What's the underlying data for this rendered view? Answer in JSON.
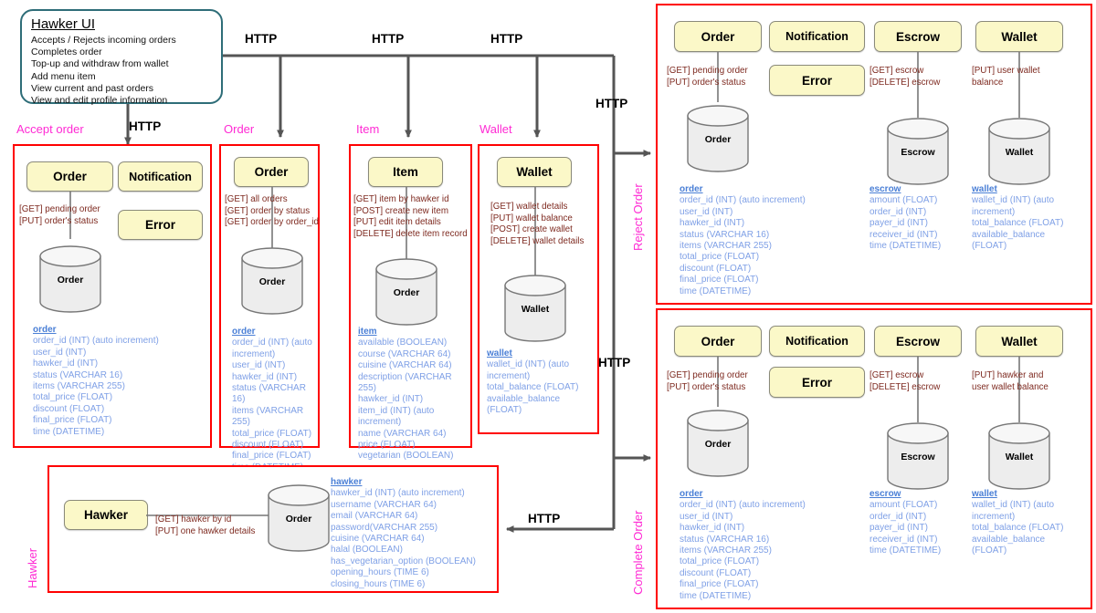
{
  "ui_box": {
    "title": "Hawker UI",
    "lines": [
      "Accepts / Rejects incoming orders",
      "Completes order",
      "Top-up and withdraw from wallet",
      "Add menu item",
      "View current and past orders",
      "View and edit profile information"
    ]
  },
  "connector_labels": {
    "http": "HTTP",
    "http_top_1": "HTTP",
    "http_top_2": "HTTP",
    "http_top_3": "HTTP",
    "http_accept": "HTTP",
    "http_right_top": "HTTP",
    "http_right_bottom": "HTTP",
    "http_bottom": "HTTP"
  },
  "group_labels": {
    "accept_order": "Accept order",
    "order": "Order",
    "item": "Item",
    "wallet": "Wallet",
    "hawker": "Hawker",
    "reject_order": "Reject Order",
    "complete_order": "Complete Order"
  },
  "colors": {
    "group_border": "#ff0000",
    "magenta_label": "#ff2ad4",
    "service_fill": "#fbf8c8",
    "service_border": "#8a8a7a",
    "endpoint_text": "#7e2a20",
    "schema_text": "#7fa0e6",
    "schema_title": "#4a7fd6",
    "ui_border": "#2e6d78",
    "connector": "#555555"
  },
  "schemas": {
    "order": {
      "name": "order",
      "fields": [
        "order_id (INT) (auto increment)",
        "user_id (INT)",
        "hawker_id (INT)",
        "status (VARCHAR 16)",
        "items (VARCHAR 255)",
        "total_price (FLOAT)",
        "discount (FLOAT)",
        "final_price (FLOAT)",
        "time (DATETIME)"
      ]
    },
    "item": {
      "name": "item",
      "fields": [
        "available (BOOLEAN)",
        "course (VARCHAR 64)",
        "cuisine (VARCHAR 64)",
        "description (VARCHAR 255)",
        "hawker_id (INT)",
        "item_id (INT) (auto increment)",
        "name (VARCHAR 64)",
        "price (FLOAT)",
        "vegetarian (BOOLEAN)"
      ]
    },
    "wallet": {
      "name": "wallet",
      "fields": [
        "wallet_id (INT) (auto increment)",
        "total_balance (FLOAT)",
        "available_balance (FLOAT)"
      ]
    },
    "escrow": {
      "name": "escrow",
      "fields": [
        "amount (FLOAT)",
        "order_id (INT)",
        "payer_id (INT)",
        "receiver_id (INT)",
        "time (DATETIME)"
      ]
    },
    "hawker": {
      "name": "hawker",
      "fields": [
        "hawker_id (INT) (auto increment)",
        "username (VARCHAR 64)",
        "email (VARCHAR 64)",
        "password(VARCHAR 255)",
        "cuisine (VARCHAR 64)",
        "halal (BOOLEAN)",
        "has_vegetarian_option (BOOLEAN)",
        "opening_hours (TIME 6)",
        "closing_hours (TIME 6)"
      ]
    }
  },
  "panels": {
    "accept_order": {
      "label": "Accept order",
      "services": [
        "Order",
        "Notification",
        "Error"
      ],
      "endpoints": [
        "[GET] pending order",
        "[PUT] order's status"
      ],
      "db_label": "Order",
      "schema_key": "order"
    },
    "order": {
      "label": "Order",
      "service": "Order",
      "endpoints": [
        "[GET] all orders",
        "[GET] order by status",
        "[GET] order by order_id"
      ],
      "db_label": "Order",
      "schema_key": "order"
    },
    "item": {
      "label": "Item",
      "service": "Item",
      "endpoints": [
        "[GET] item by hawker id",
        "[POST] create new item",
        "[PUT] edit item details",
        "[DELETE] delete item record"
      ],
      "db_label": "Order",
      "schema_key": "item"
    },
    "wallet": {
      "label": "Wallet",
      "service": "Wallet",
      "endpoints": [
        "[GET] wallet details",
        "[PUT] wallet balance",
        "[POST] create wallet",
        "[DELETE] wallet details"
      ],
      "db_label": "Wallet",
      "schema_key": "wallet"
    },
    "hawker": {
      "label": "Hawker",
      "service": "Hawker",
      "endpoints": [
        "[GET] hawker by id",
        "[PUT] one hawker details"
      ],
      "db_label": "Order",
      "schema_key": "hawker"
    },
    "reject_order": {
      "label": "Reject Order",
      "services": [
        "Order",
        "Notification",
        "Escrow",
        "Wallet",
        "Error"
      ],
      "order_endpoints": [
        "[GET] pending order",
        "[PUT] order's status"
      ],
      "escrow_endpoints": [
        "[GET] escrow",
        "[DELETE] escrow"
      ],
      "wallet_endpoints": "[PUT] user wallet balance",
      "db_order": "Order",
      "db_escrow": "Escrow",
      "db_wallet": "Wallet"
    },
    "complete_order": {
      "label": "Complete Order",
      "services": [
        "Order",
        "Notification",
        "Escrow",
        "Wallet",
        "Error"
      ],
      "order_endpoints": [
        "[GET] pending order",
        "[PUT] order's status"
      ],
      "escrow_endpoints": [
        "[GET] escrow",
        "[DELETE] escrow"
      ],
      "wallet_endpoints": "[PUT] hawker and user wallet balance",
      "db_order": "Order",
      "db_escrow": "Escrow",
      "db_wallet": "Wallet"
    }
  }
}
